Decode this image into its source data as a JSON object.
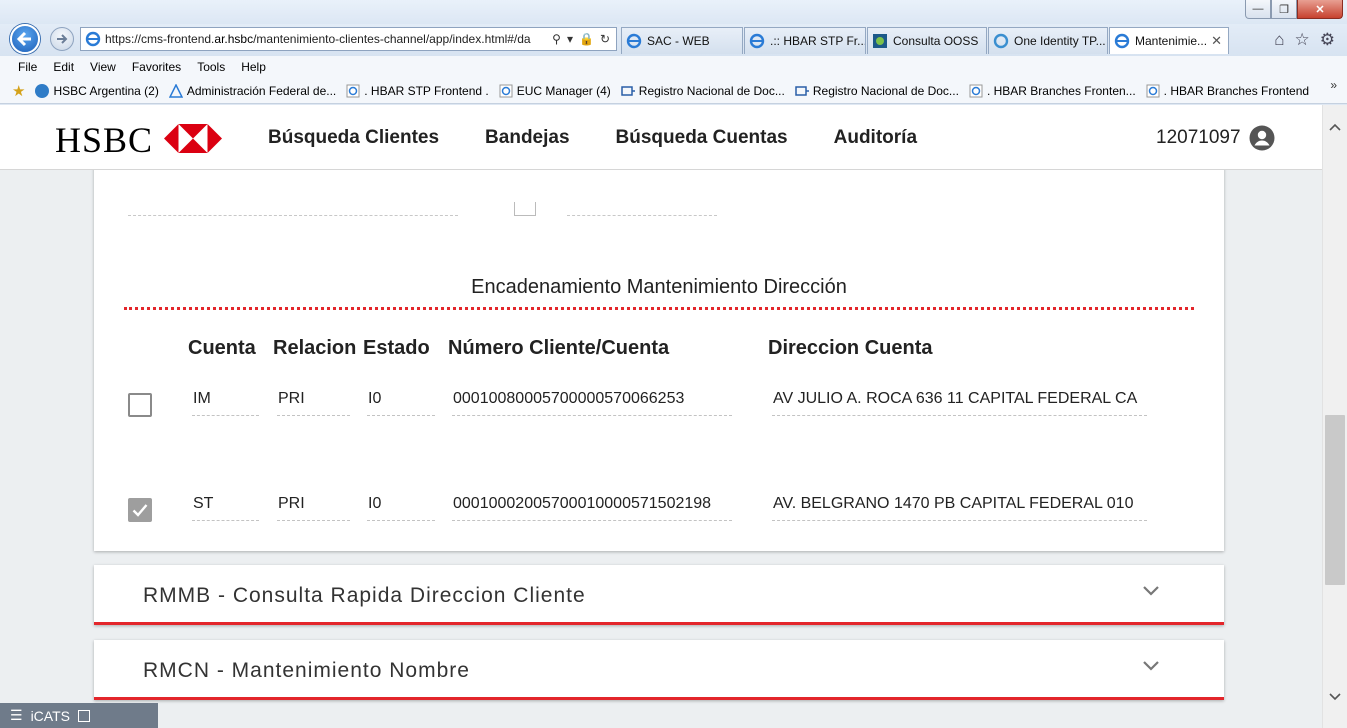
{
  "browser": {
    "window_controls": [
      "minimize",
      "restore",
      "close"
    ],
    "address": {
      "prefix": "https://cms-frontend.",
      "domain": "ar.hsbc",
      "suffix": "/mantenimiento-clientes-channel/app/index.html#/da"
    },
    "tabs": [
      {
        "label": "SAC - WEB",
        "icon": "ie-page-icon"
      },
      {
        "label": ".:: HBAR STP Fr...",
        "icon": "ie-page-icon"
      },
      {
        "label": "Consulta OOSS",
        "icon": "ooss-icon"
      },
      {
        "label": "One Identity TP...",
        "icon": "identity-icon"
      },
      {
        "label": "Mantenimie...",
        "icon": "ie-page-icon",
        "active": true
      }
    ],
    "menu": [
      "File",
      "Edit",
      "View",
      "Favorites",
      "Tools",
      "Help"
    ],
    "favorites": [
      "HSBC Argentina (2)",
      "Administración Federal de...",
      ". HBAR STP Frontend .",
      "EUC Manager (4)",
      "Registro Nacional de Doc...",
      "Registro Nacional de Doc...",
      ". HBAR Branches Fronten...",
      ". HBAR Branches Frontend"
    ]
  },
  "app": {
    "brand": "HSBC",
    "brand_red": "#db0011",
    "nav": [
      "Búsqueda Clientes",
      "Bandejas",
      "Búsqueda Cuentas",
      "Auditoría"
    ],
    "user_id": "12071097"
  },
  "section": {
    "title": "Encadenamiento Mantenimiento Dirección",
    "headers": {
      "cuenta": "Cuenta",
      "relacion": "Relacion",
      "estado": "Estado",
      "numero": "Número Cliente/Cuenta",
      "direccion": "Direccion Cuenta"
    },
    "rows": [
      {
        "checked": false,
        "cuenta": "IM",
        "relacion": "PRI",
        "estado": "I0",
        "numero": "00010080005700000570066253",
        "direccion": "AV JULIO A. ROCA 636 11 CAPITAL FEDERAL CA"
      },
      {
        "checked": true,
        "cuenta": "ST",
        "relacion": "PRI",
        "estado": "I0",
        "numero": "00010002005700010000571502198",
        "direccion": "AV. BELGRANO 1470 PB CAPITAL FEDERAL 010"
      }
    ]
  },
  "accordions": [
    {
      "title": "RMMB - Consulta Rapida Direccion Cliente"
    },
    {
      "title": "RMCN - Mantenimiento Nombre"
    }
  ],
  "taskbar": {
    "label": "iCATS"
  },
  "colors": {
    "accent_red": "#e3262b",
    "ie_blue": "#1d5fb8"
  }
}
